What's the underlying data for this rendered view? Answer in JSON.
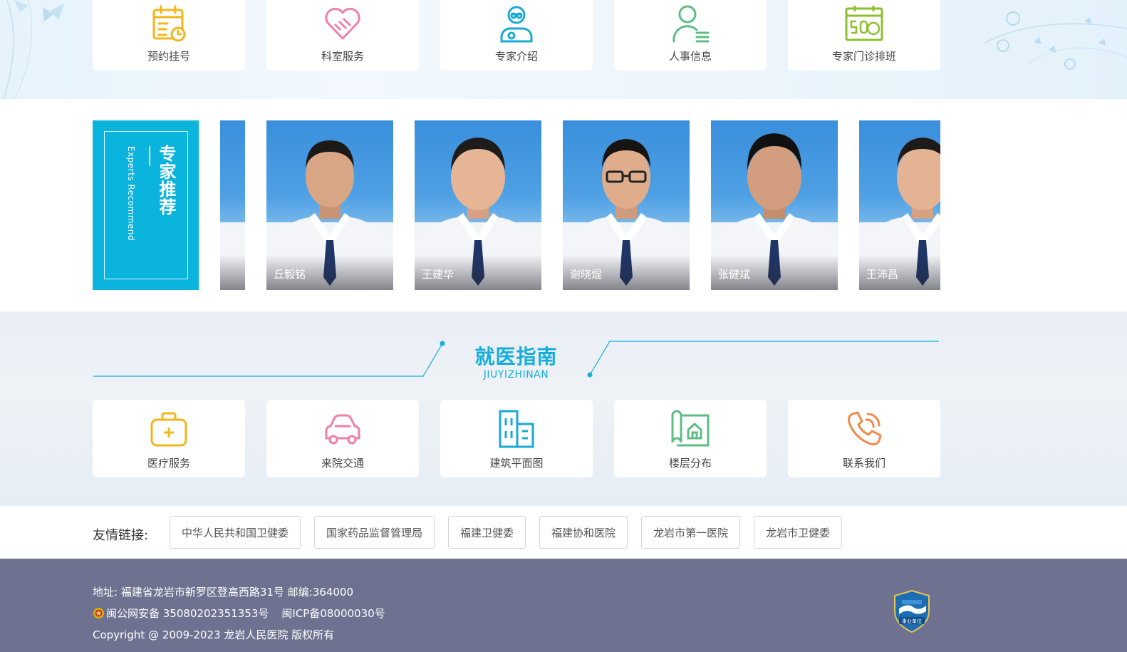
{
  "quick_services": [
    {
      "label": "预约挂号",
      "icon": "calendar-clock-icon",
      "color": "#f3b61a"
    },
    {
      "label": "科室服务",
      "icon": "heart-handshake-icon",
      "color": "#ef7fa9"
    },
    {
      "label": "专家介绍",
      "icon": "doctor-icon",
      "color": "#1aa9d6"
    },
    {
      "label": "人事信息",
      "icon": "person-list-icon",
      "color": "#5dbd85"
    },
    {
      "label": "专家门诊排班",
      "icon": "schedule-calendar-icon",
      "color": "#8cbf2e"
    }
  ],
  "experts": {
    "title": "专家推荐",
    "subtitle": "Experts Recommend",
    "doctors": [
      {
        "name": ""
      },
      {
        "name": "丘毅铭"
      },
      {
        "name": "王建华"
      },
      {
        "name": "谢晓焜"
      },
      {
        "name": "张健斌"
      },
      {
        "name": "王沛昌"
      }
    ]
  },
  "guide": {
    "title": "就医指南",
    "subtitle": "JIUYIZHINAN",
    "accent": "#15aedb",
    "items": [
      {
        "label": "医疗服务",
        "icon": "medical-kit-icon",
        "color": "#f3b61a"
      },
      {
        "label": "来院交通",
        "icon": "car-icon",
        "color": "#ef7fa9"
      },
      {
        "label": "建筑平面图",
        "icon": "building-icon",
        "color": "#1aa9d6"
      },
      {
        "label": "楼层分布",
        "icon": "floor-map-icon",
        "color": "#5dbd85"
      },
      {
        "label": "联系我们",
        "icon": "phone-icon",
        "color": "#f08a4b"
      }
    ]
  },
  "friend_links": {
    "label": "友情链接:",
    "items": [
      "中华人民共和国卫健委",
      "国家药品监督管理局",
      "福建卫健委",
      "福建协和医院",
      "龙岩市第一医院",
      "龙岩市卫健委"
    ]
  },
  "footer": {
    "address": "地址:  福建省龙岩市新罗区登高西路31号   邮编:364000",
    "police_record": "闽公网安备 35080202351353号",
    "icp": "闽ICP备08000030号",
    "copyright": "Copyright @ 2009-2023 龙岩人民医院 版权所有",
    "badge_text": "事业单位",
    "background": "#6e7290"
  }
}
